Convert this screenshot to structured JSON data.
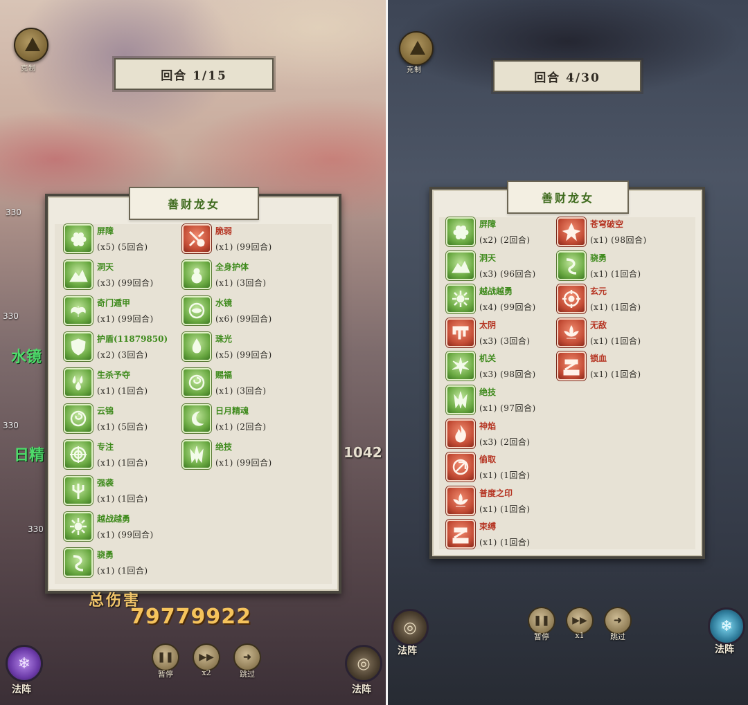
{
  "left": {
    "emblem_label": "克制",
    "round": "回合 1/15",
    "panel_title": "善财龙女",
    "buffs_col1": [
      {
        "name": "屏障",
        "detail": "(x5)  (5回合)",
        "color": "green",
        "icon": "honeycomb-icon"
      },
      {
        "name": "洞天",
        "detail": "(x3)  (99回合)",
        "color": "green",
        "icon": "mountain-icon"
      },
      {
        "name": "奇门遁甲",
        "detail": "(x1)  (99回合)",
        "color": "green",
        "icon": "wings-icon"
      },
      {
        "name": "护盾(11879850)",
        "detail": "(x2)  (3回合)",
        "color": "green",
        "icon": "shield-icon"
      },
      {
        "name": "生杀予夺",
        "detail": "(x1)  (1回合)",
        "color": "green",
        "icon": "droplets-icon"
      },
      {
        "name": "云锦",
        "detail": "(x1)  (5回合)",
        "color": "green",
        "icon": "swirl-icon"
      },
      {
        "name": "专注",
        "detail": "(x1)  (1回合)",
        "color": "green",
        "icon": "target-icon"
      },
      {
        "name": "强袭",
        "detail": "(x1)  (1回合)",
        "color": "green",
        "icon": "trident-icon"
      },
      {
        "name": "越战越勇",
        "detail": "(x1)  (99回合)",
        "color": "green",
        "icon": "sunburst-icon"
      },
      {
        "name": "骁勇",
        "detail": "(x1)  (1回合)",
        "color": "green",
        "icon": "curve-icon"
      }
    ],
    "buffs_col2": [
      {
        "name": "脆弱",
        "detail": "(x1)  (99回合)",
        "color": "red",
        "icon": "broken-shield-icon"
      },
      {
        "name": "全身护体",
        "detail": "(x1)  (3回合)",
        "color": "green",
        "icon": "gourd-icon"
      },
      {
        "name": "水镜",
        "detail": "(x6)  (99回合)",
        "color": "green",
        "icon": "water-mirror-icon"
      },
      {
        "name": "珠光",
        "detail": "(x5)  (99回合)",
        "color": "green",
        "icon": "drop-icon"
      },
      {
        "name": "赐福",
        "detail": "(x1)  (3回合)",
        "color": "green",
        "icon": "swirl-icon"
      },
      {
        "name": "日月精魂",
        "detail": "(x1)  (2回合)",
        "color": "green",
        "icon": "moon-icon"
      },
      {
        "name": "绝技",
        "detail": "(x1)  (99回合)",
        "color": "green",
        "icon": "blades-icon"
      }
    ],
    "total_damage_label": "总伤害",
    "total_damage_value": "79779922",
    "controls": {
      "pause": "暂停",
      "speed": "x2",
      "skip": "跳过"
    },
    "formation_label": "法阵",
    "side_numbers": [
      "330",
      "330",
      "330",
      "330"
    ],
    "side_text_1": "水镜",
    "side_text_2": "日精",
    "side_damage": "1042"
  },
  "right": {
    "emblem_label": "克制",
    "round": "回合 4/30",
    "panel_title": "善财龙女",
    "buffs_col1": [
      {
        "name": "屏障",
        "detail": "(x2)  (2回合)",
        "color": "green",
        "icon": "honeycomb-icon"
      },
      {
        "name": "洞天",
        "detail": "(x3)  (96回合)",
        "color": "green",
        "icon": "mountain-icon"
      },
      {
        "name": "越战越勇",
        "detail": "(x4)  (99回合)",
        "color": "green",
        "icon": "sunburst-icon"
      },
      {
        "name": "太阴",
        "detail": "(x3)  (3回合)",
        "color": "red",
        "icon": "drip-icon"
      },
      {
        "name": "机关",
        "detail": "(x3)  (98回合)",
        "color": "green",
        "icon": "burst-icon"
      },
      {
        "name": "绝技",
        "detail": "(x1)  (97回合)",
        "color": "green",
        "icon": "blades-icon"
      },
      {
        "name": "神焰",
        "detail": "(x3)  (2回合)",
        "color": "red",
        "icon": "flame-icon"
      },
      {
        "name": "偷取",
        "detail": "(x1)  (1回合)",
        "color": "red",
        "icon": "grab-icon"
      },
      {
        "name": "普度之印",
        "detail": "(x1)  (1回合)",
        "color": "red",
        "icon": "lotus-icon"
      },
      {
        "name": "束缚",
        "detail": "(x1)  (1回合)",
        "color": "red",
        "icon": "bind-icon"
      }
    ],
    "buffs_col2": [
      {
        "name": "苍穹破空",
        "detail": "(x1)  (98回合)",
        "color": "red",
        "icon": "spike-icon"
      },
      {
        "name": "骁勇",
        "detail": "(x1)  (1回合)",
        "color": "green",
        "icon": "curve-icon"
      },
      {
        "name": "玄元",
        "detail": "(x1)  (1回合)",
        "color": "red",
        "icon": "crosshair-icon"
      },
      {
        "name": "无敌",
        "detail": "(x1)  (1回合)",
        "color": "red",
        "icon": "lotus-icon"
      },
      {
        "name": "锁血",
        "detail": "(x1)  (1回合)",
        "color": "red",
        "icon": "bind-icon"
      }
    ],
    "controls": {
      "pause": "暂停",
      "speed": "x1",
      "skip": "跳过"
    },
    "formation_label": "法阵"
  }
}
